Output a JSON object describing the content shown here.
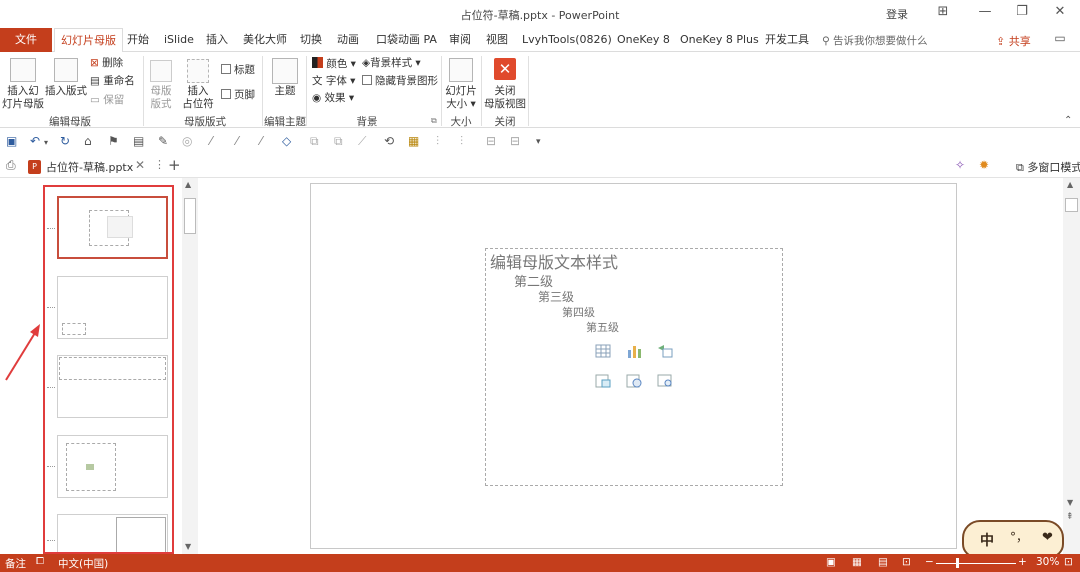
{
  "window": {
    "title": "占位符-草稿.pptx  -  PowerPoint",
    "login": "登录"
  },
  "tabs": {
    "file": "文件",
    "slide_master": "幻灯片母版",
    "home": "开始",
    "islide": "iSlide",
    "insert": "插入",
    "beautify": "美化大师",
    "transitions": "切换",
    "animations": "动画",
    "pocket": "口袋动画 PA",
    "review": "审阅",
    "view": "视图",
    "lvyh": "LvyhTools(0826)",
    "onekey8": "OneKey 8",
    "onekey8plus": "OneKey 8 Plus",
    "devtools": "开发工具",
    "tell_me": "告诉我你想要做什么",
    "share": "共享"
  },
  "ribbon": {
    "insert_slide_master_1": "插入幻",
    "insert_slide_master_2": "灯片母版",
    "insert_layout": "插入版式",
    "delete": "删除",
    "rename": "重命名",
    "preserve": "保留",
    "group_edit_master": "编辑母版",
    "master_layout_1": "母版",
    "master_layout_2": "版式",
    "insert_placeholder_1": "插入",
    "insert_placeholder_2": "占位符",
    "title_cb": "标题",
    "footer_cb": "页脚",
    "group_master_layout": "母版版式",
    "themes": "主题",
    "group_edit_theme": "编辑主题",
    "colors": "颜色",
    "fonts": "字体",
    "effects": "效果",
    "bg_styles": "背景样式",
    "hide_bg": "隐藏背景图形",
    "group_background": "背景",
    "slide_size_1": "幻灯片",
    "slide_size_2": "大小",
    "group_size": "大小",
    "close_1": "关闭",
    "close_2": "母版视图",
    "group_close": "关闭"
  },
  "doc": {
    "tab_name": "占位符-草稿.pptx",
    "multi_window": "多窗口模式"
  },
  "slide": {
    "level1": "编辑母版文本样式",
    "level2": "第二级",
    "level3": "第三级",
    "level4": "第四级",
    "level5": "第五级"
  },
  "status": {
    "notes": "备注",
    "language": "中文(中国)",
    "zoom": "30%"
  },
  "mascot": {
    "left": "中",
    "mid": "°，",
    "heart": "❤"
  },
  "colors": {
    "accent": "#c43e1c",
    "highlight": "#e03c3c"
  }
}
